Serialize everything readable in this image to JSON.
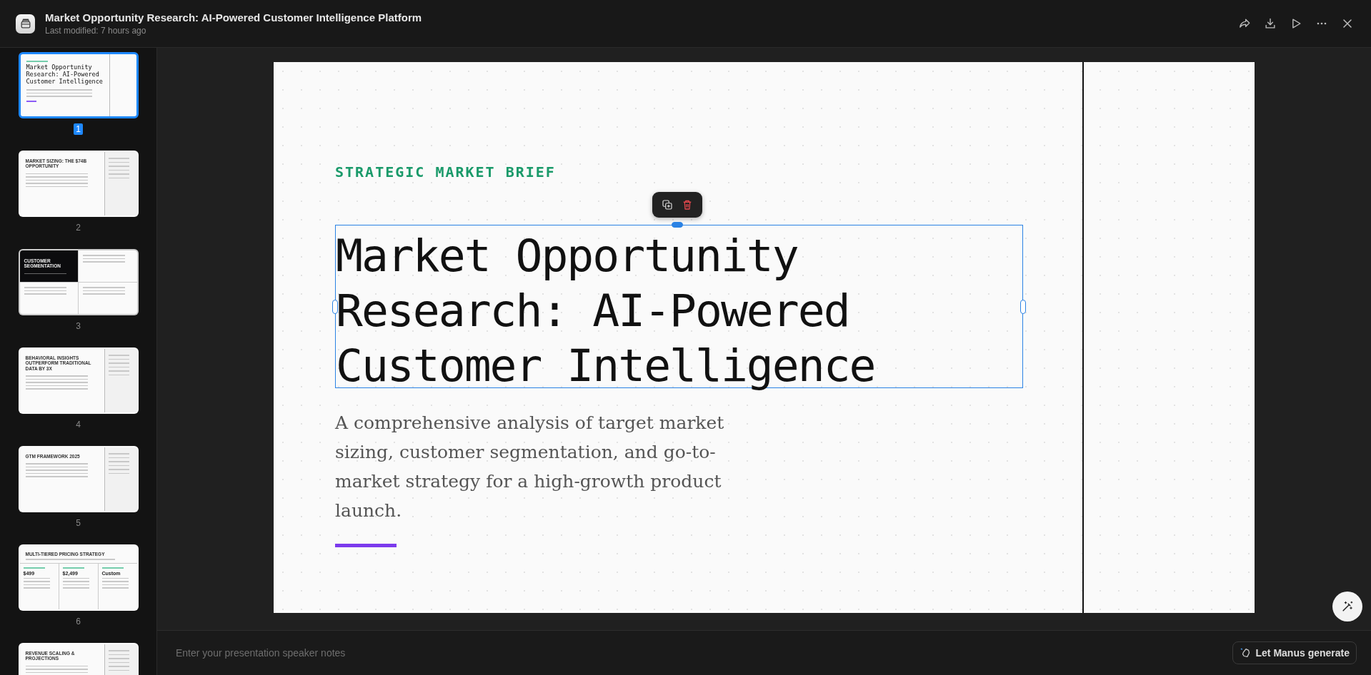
{
  "window": {
    "title": "Market Opportunity Research: AI-Powered Customer Intelligence Platform",
    "subtitle": "Last modified: 7 hours ago"
  },
  "slides": [
    {
      "number": "1",
      "selected": true,
      "kind": "title",
      "title": "Market Opportunity Research: AI-Powered Customer Intelligence"
    },
    {
      "number": "2",
      "selected": false,
      "kind": "split",
      "title": "MARKET SIZING: THE $74B OPPORTUNITY"
    },
    {
      "number": "3",
      "selected": false,
      "kind": "quad",
      "title": "CUSTOMER SEGMENTATION"
    },
    {
      "number": "4",
      "selected": false,
      "kind": "split",
      "title": "BEHAVIORAL INSIGHTS OUTPERFORM TRADITIONAL DATA BY 3X"
    },
    {
      "number": "5",
      "selected": false,
      "kind": "split",
      "title": "GTM FRAMEWORK 2025"
    },
    {
      "number": "6",
      "selected": false,
      "kind": "columns",
      "title": "MULTI-TIERED PRICING STRATEGY",
      "prices": [
        "$499",
        "$2,499",
        "Custom"
      ]
    },
    {
      "kind": "split",
      "selected": false,
      "title": "REVENUE SCALING & PROJECTIONS"
    }
  ],
  "slide": {
    "eyebrow": "STRATEGIC MARKET BRIEF",
    "title": "Market Opportunity Research: AI-Powered Customer Intelligence",
    "subtitle": "A comprehensive analysis of target market sizing, customer segmentation, and go-to-market strategy for a high-growth product launch."
  },
  "notes": {
    "placeholder": "Enter your presentation speaker notes"
  },
  "generate_button": "Let Manus generate"
}
